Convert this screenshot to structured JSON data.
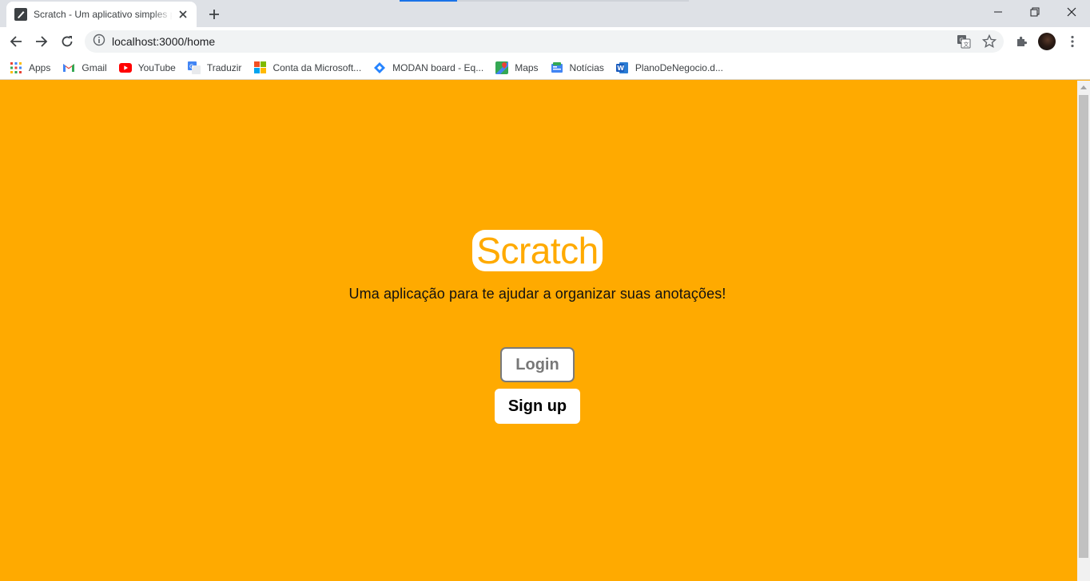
{
  "browser": {
    "tab": {
      "title": "Scratch - Um aplicativo simples para",
      "favicon": "pencil-icon"
    },
    "address": "localhost:3000/home",
    "bookmarks": [
      {
        "label": "Apps",
        "icon": "apps-grid-icon"
      },
      {
        "label": "Gmail",
        "icon": "gmail-icon"
      },
      {
        "label": "YouTube",
        "icon": "youtube-icon"
      },
      {
        "label": "Traduzir",
        "icon": "translate-icon"
      },
      {
        "label": "Conta da Microsoft...",
        "icon": "microsoft-icon"
      },
      {
        "label": "MODAN board - Eq...",
        "icon": "jira-icon"
      },
      {
        "label": "Maps",
        "icon": "maps-icon"
      },
      {
        "label": "Notícias",
        "icon": "news-icon"
      },
      {
        "label": "PlanoDeNegocio.d...",
        "icon": "word-icon"
      }
    ]
  },
  "page": {
    "title": "Scratch",
    "subtitle": "Uma aplicação para te ajudar a organizar suas anotações!",
    "login_label": "Login",
    "signup_label": "Sign up"
  },
  "colors": {
    "background": "#ffaa00",
    "title_text": "#ffaa00",
    "button_bg": "#ffffff"
  }
}
